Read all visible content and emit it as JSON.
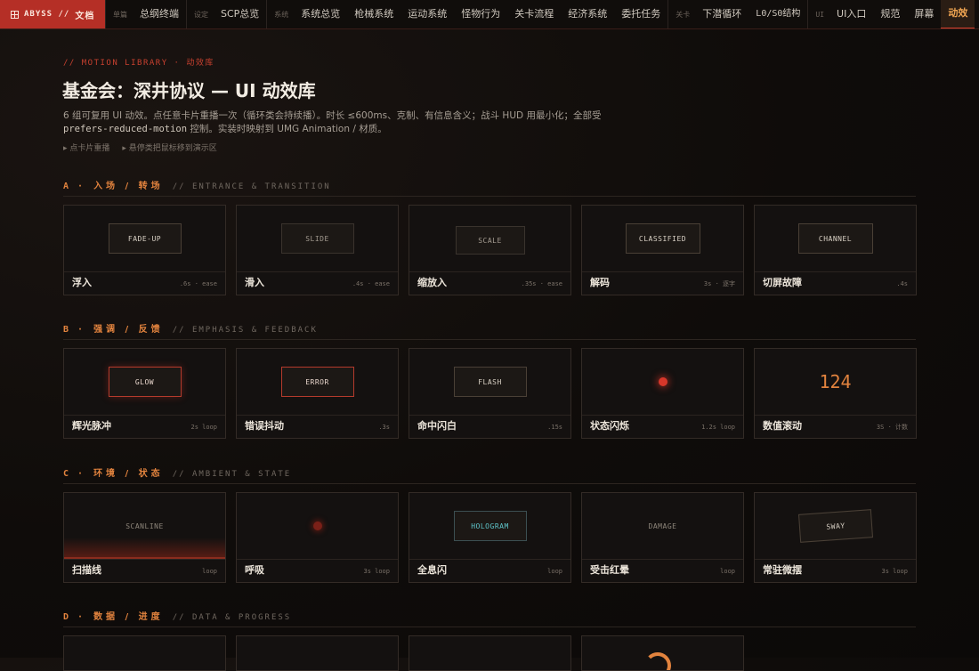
{
  "nav": {
    "brand": {
      "code": "ABYSS // ",
      "zh": "文档"
    },
    "groups": [
      {
        "label": "单篇",
        "items": [
          "总纲终端"
        ]
      },
      {
        "label": "设定",
        "items": [
          "SCP总览"
        ]
      },
      {
        "label": "系统",
        "items": [
          "系统总览",
          "枪械系统",
          "运动系统",
          "怪物行为",
          "关卡流程",
          "经济系统",
          "委托任务"
        ]
      },
      {
        "label": "关卡",
        "items": [
          "下潜循环",
          "L0/S0结构"
        ]
      },
      {
        "label": "UI",
        "items": [
          "UI入口",
          "规范",
          "屏幕",
          "动效"
        ]
      }
    ],
    "active_item": "动效"
  },
  "header": {
    "kicker": "// MOTION LIBRARY · 动效库",
    "title": "基金会：深井协议 — UI 动效库",
    "desc_1": "6 组可复用 UI 动效。点任意卡片重播一次（循环类会持续播）。时长 ≤600ms、克制、有信息含义；战斗 HUD 用最小化；全部受",
    "desc_code": "prefers-reduced-motion",
    "desc_2": " 控制。实装时映射到 UMG Animation / 材质。",
    "hints": [
      "点卡片重播",
      "悬停类把鼠标移到演示区"
    ]
  },
  "sections": [
    {
      "letter": "A ·",
      "zh": "入场 / 转场",
      "en": "// ENTRANCE & TRANSITION",
      "cards": [
        {
          "demo": "FADE-UP",
          "name": "浮入",
          "meta": ".6s · ease"
        },
        {
          "demo": "SLIDE",
          "name": "滑入",
          "meta": ".4s · ease"
        },
        {
          "demo": "SCALE",
          "name": "缩放入",
          "meta": ".35s · ease"
        },
        {
          "demo": "CLASSIFIED",
          "name": "解码",
          "meta": "3s · 逐字"
        },
        {
          "demo": "CHANNEL",
          "name": "切屏故障",
          "meta": ".4s"
        }
      ]
    },
    {
      "letter": "B ·",
      "zh": "强调 / 反馈",
      "en": "// EMPHASIS & FEEDBACK",
      "cards": [
        {
          "demo": "GLOW",
          "name": "辉光脉冲",
          "meta": "2s loop"
        },
        {
          "demo": "ERROR",
          "name": "错误抖动",
          "meta": ".3s"
        },
        {
          "demo": "FLASH",
          "name": "命中闪白",
          "meta": ".15s"
        },
        {
          "demo": "",
          "name": "状态闪烁",
          "meta": "1.2s loop"
        },
        {
          "demo": "124",
          "name": "数值滚动",
          "meta": "3S · 计数"
        }
      ]
    },
    {
      "letter": "C ·",
      "zh": "环境 / 状态",
      "en": "// AMBIENT & STATE",
      "cards": [
        {
          "demo": "SCANLINE",
          "name": "扫描线",
          "meta": "loop"
        },
        {
          "demo": "",
          "name": "呼吸",
          "meta": "3s loop"
        },
        {
          "demo": "HOLOGRAM",
          "name": "全息闪",
          "meta": "loop"
        },
        {
          "demo": "DAMAGE",
          "name": "受击红晕",
          "meta": "loop"
        },
        {
          "demo": "SWAY",
          "name": "常驻微摆",
          "meta": "3s loop"
        }
      ]
    },
    {
      "letter": "D ·",
      "zh": "数据 / 进度",
      "en": "// DATA & PROGRESS",
      "cards": []
    }
  ]
}
